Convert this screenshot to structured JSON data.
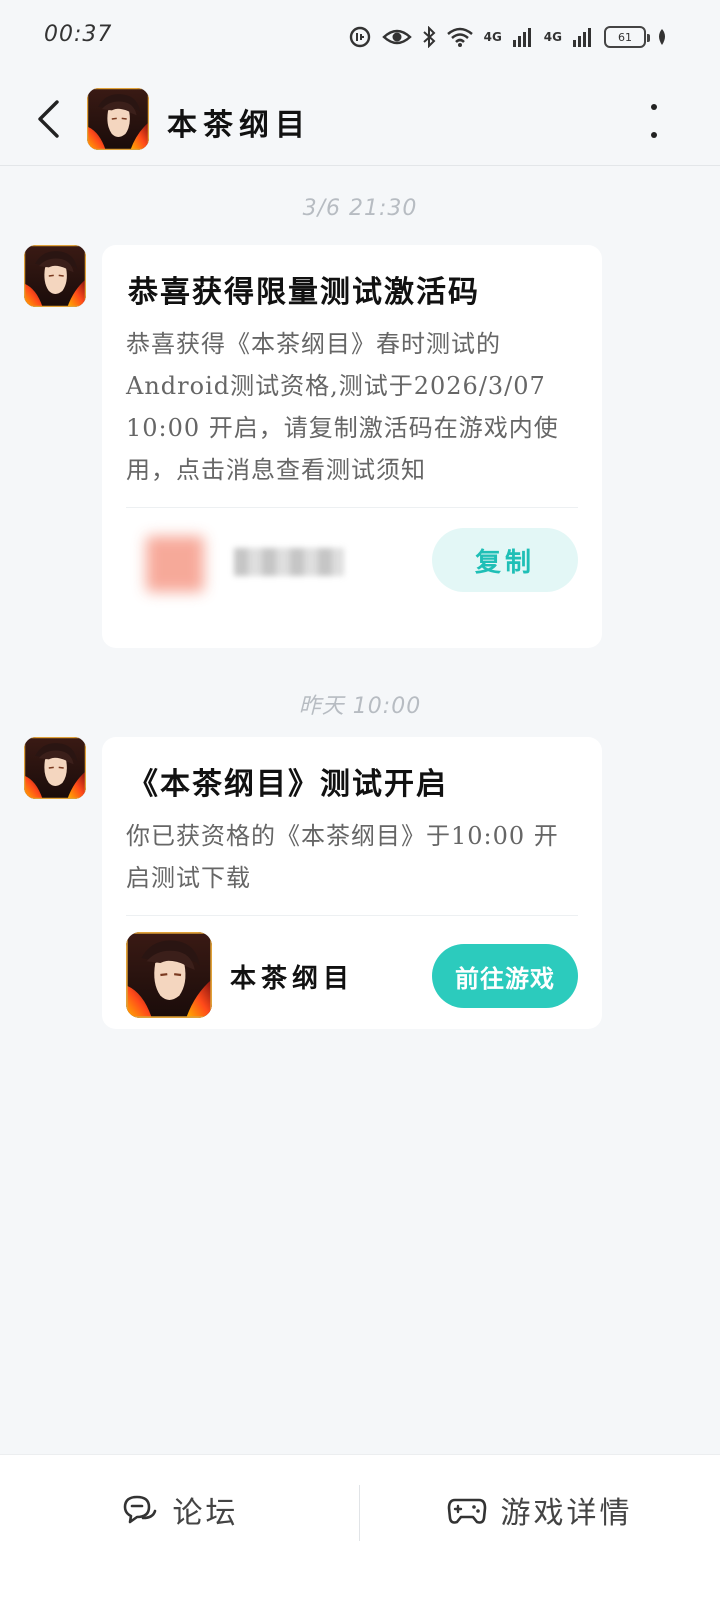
{
  "status_bar": {
    "time": "00:37",
    "net1": "4G",
    "net2": "4G",
    "battery": "61"
  },
  "header": {
    "title": "本茶纲目"
  },
  "messages": [
    {
      "time": "3/6 21:30",
      "title": "恭喜获得限量测试激活码",
      "body": "恭喜获得《本茶纲目》春时测试的Android测试资格,测试于2026/3/07 10:00 开启，请复制激活码在游戏内使用，点击消息查看测试须知",
      "button": "复制"
    },
    {
      "time": "昨天 10:00",
      "title": "《本茶纲目》测试开启",
      "body": "你已获资格的《本茶纲目》于10:00 开启测试下载",
      "game_name": "本茶纲目",
      "button": "前往游戏"
    }
  ],
  "bottom_tabs": [
    {
      "label": "论坛",
      "icon": "forum-icon"
    },
    {
      "label": "游戏详情",
      "icon": "gamepad-icon"
    }
  ],
  "colors": {
    "accent": "#2ccbbd",
    "accent_light": "#e3f7f6",
    "background": "#f5f7f9"
  }
}
